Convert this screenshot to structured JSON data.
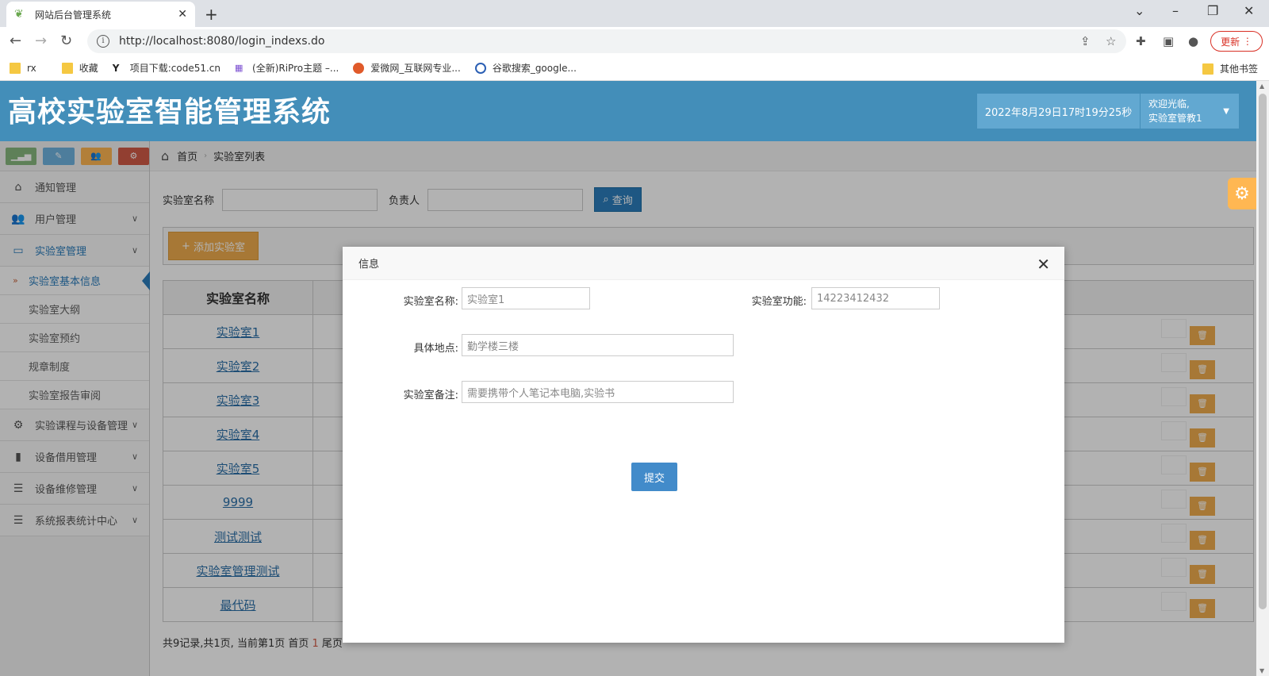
{
  "browser": {
    "tab_title": "网站后台管理系统",
    "url": "http://localhost:8080/login_indexs.do",
    "update_label": "更新",
    "bookmarks": [
      {
        "label": "rx",
        "icon": "folder-icon"
      },
      {
        "label": "收藏",
        "icon": "folder-icon"
      },
      {
        "label": "项目下载:code51.cn",
        "icon": "y-logo-icon"
      },
      {
        "label": "(全新)RiPro主题 –...",
        "icon": "ripro-icon"
      },
      {
        "label": "爱微网_互联网专业...",
        "icon": "aiwei-icon"
      },
      {
        "label": "谷歌搜索_google...",
        "icon": "google-363-icon"
      }
    ],
    "other_bookmarks": "其他书签"
  },
  "header": {
    "title": "高校实验室智能管理系统",
    "datetime": "2022年8月29日17时19分25秒",
    "welcome": "欢迎光临,",
    "user": "实验室管教1"
  },
  "sidebar": {
    "menu": [
      {
        "label": "通知管理",
        "icon": "home-icon"
      },
      {
        "label": "用户管理",
        "icon": "users-icon"
      },
      {
        "label": "实验室管理",
        "icon": "desktop-icon"
      }
    ],
    "submenu": [
      {
        "label": "实验室基本信息"
      },
      {
        "label": "实验室大纲"
      },
      {
        "label": "实验室预约"
      },
      {
        "label": "规章制度"
      },
      {
        "label": "实验室报告审阅"
      }
    ],
    "menu2": [
      {
        "label": "实验课程与设备管理",
        "icon": "cogs-icon"
      },
      {
        "label": "设备借用管理",
        "icon": "bookmark-icon"
      },
      {
        "label": "设备维修管理",
        "icon": "list-icon"
      },
      {
        "label": "系统报表统计中心",
        "icon": "list-icon"
      }
    ]
  },
  "breadcrumb": {
    "home": "首页",
    "current": "实验室列表"
  },
  "search": {
    "name_label": "实验室名称",
    "owner_label": "负责人",
    "query_label": "查询"
  },
  "add_button": "添加实验室",
  "table": {
    "header": "实验室名称",
    "rows": [
      "实验室1",
      "实验室2",
      "实验室3",
      "实验室4",
      "实验室5",
      "9999",
      "测试测试",
      "实验室管理测试",
      "最代码"
    ]
  },
  "pager": {
    "before": "共9记录,共1页, 当前第1页 首页 ",
    "current": "1",
    "after": " 尾页"
  },
  "modal": {
    "title": "信息",
    "name_label": "实验室名称:",
    "name_value": "实验室1",
    "function_label": "实验室功能:",
    "function_value": "14223412432",
    "location_label": "具体地点:",
    "location_value": "勤学楼三楼",
    "remark_label": "实验室备注:",
    "remark_value": "需要携带个人笔记本电脑,实验书",
    "submit_label": "提交"
  }
}
